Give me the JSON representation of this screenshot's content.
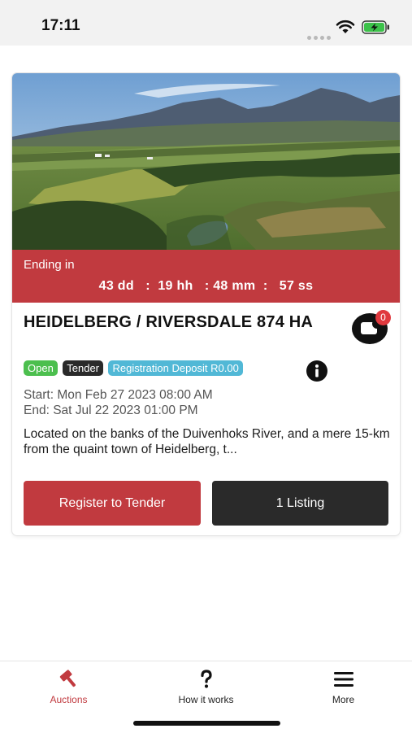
{
  "status_bar": {
    "time": "17:11"
  },
  "auction": {
    "countdown": {
      "label": "Ending in",
      "days": "43 dd",
      "hours": "19 hh",
      "minutes": "48 mm",
      "seconds": "57 ss"
    },
    "title": "HEIDELBERG / RIVERSDALE 874 HA",
    "watch_count": "0",
    "badges": {
      "status": "Open",
      "type": "Tender",
      "deposit": "Registration Deposit R0.00"
    },
    "start": "Start: Mon Feb 27 2023 08:00 AM",
    "end": "End: Sat Jul 22 2023 01:00 PM",
    "description": "Located on the banks of the Duivenhoks River, and a mere 15-km from the quaint town of Heidelberg, t...",
    "register_label": "Register to Tender",
    "listing_label": "1 Listing"
  },
  "tabs": [
    {
      "label": "Auctions",
      "icon": "gavel-icon",
      "active": true
    },
    {
      "label": "How it works",
      "icon": "question-icon"
    },
    {
      "label": "More",
      "icon": "menu-icon"
    }
  ],
  "colors": {
    "accent": "#c13a3f",
    "dark": "#2a2a2a",
    "open": "#4cbf4e",
    "deposit": "#51b8d6",
    "badge": "#e0393e"
  }
}
